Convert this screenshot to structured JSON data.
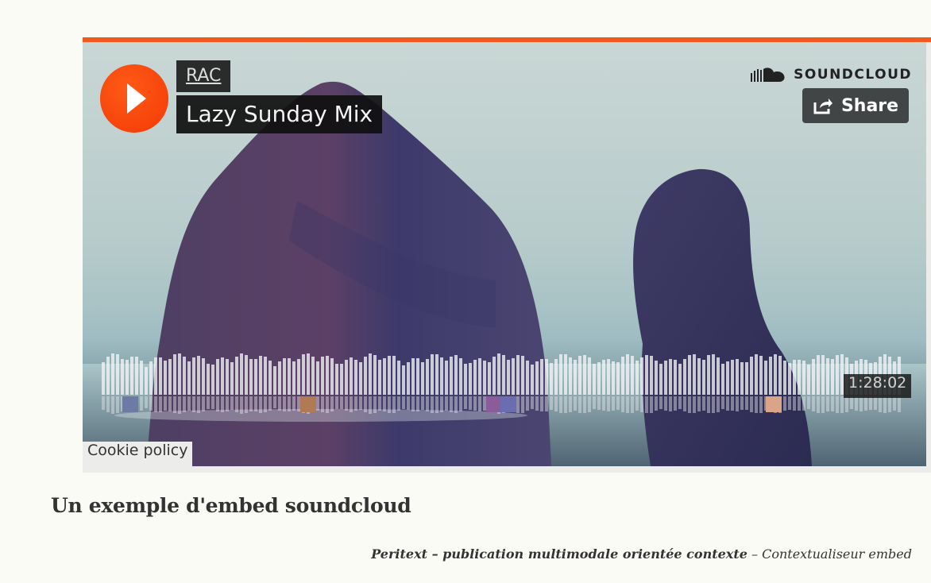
{
  "player": {
    "artist": "RAC",
    "title": "Lazy Sunday Mix",
    "brand": "SOUNDCLOUD",
    "share_label": "Share",
    "duration": "1:28:02",
    "cookie_label": "Cookie policy",
    "colors": {
      "accent": "#f15a1c",
      "play": "#ff5500"
    },
    "icons": [
      "play-icon",
      "soundcloud-logo-icon",
      "share-icon"
    ]
  },
  "caption": "Un exemple d'embed soundcloud",
  "footer": {
    "publication": "Peritext – publication multimodale orientée contexte",
    "separator": "–",
    "section": "Contextualiseur embed"
  }
}
